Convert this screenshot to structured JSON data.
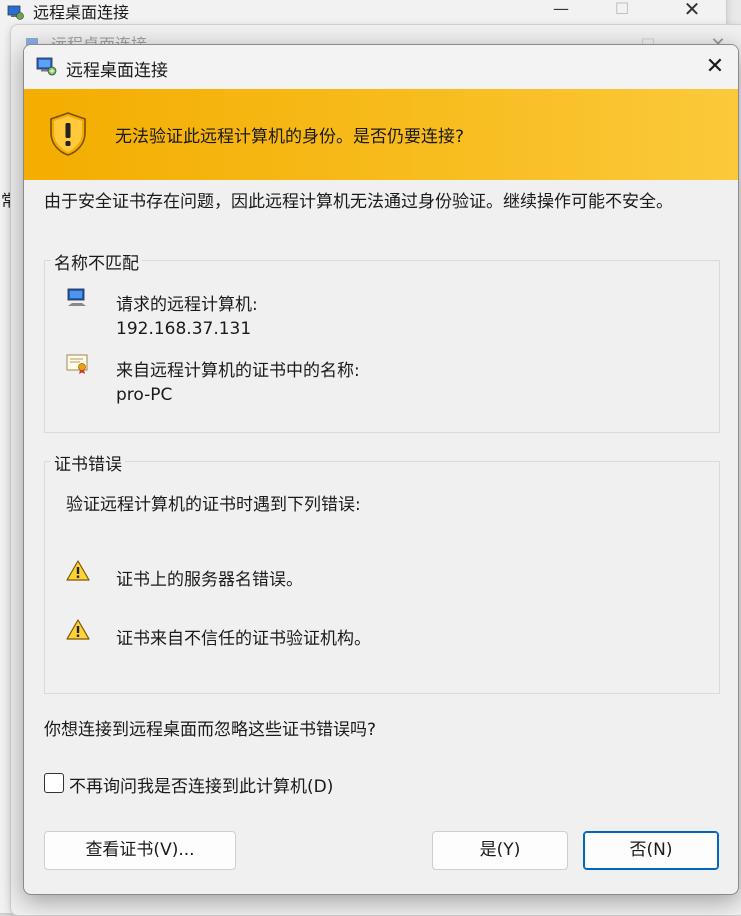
{
  "background_windows": {
    "back_title": "远程桌面连接",
    "middle_title": "远程桌面连接",
    "minimize_glyph": "—",
    "maximize_glyph": "☐",
    "close_glyph": "✕",
    "left_edge_char": "常"
  },
  "dialog": {
    "title": "远程桌面连接",
    "close_glyph": "✕",
    "banner_text": "无法验证此远程计算机的身份。是否仍要连接?",
    "description": "由于安全证书存在问题，因此远程计算机无法通过身份验证。继续操作可能不安全。",
    "name_mismatch": {
      "label": "名称不匹配",
      "requested_label": "请求的远程计算机:",
      "requested_value": "192.168.37.131",
      "cert_name_label": "来自远程计算机的证书中的名称:",
      "cert_name_value": "pro-PC"
    },
    "cert_errors": {
      "label": "证书错误",
      "intro": "验证远程计算机的证书时遇到下列错误:",
      "errors": [
        "证书上的服务器名错误。",
        "证书来自不信任的证书验证机构。"
      ]
    },
    "question": "你想连接到远程桌面而忽略这些证书错误吗?",
    "checkbox_label": "不再询问我是否连接到此计算机(D)",
    "checkbox_checked": false,
    "buttons": {
      "view_cert": "查看证书(V)...",
      "yes": "是(Y)",
      "no": "否(N)"
    },
    "colors": {
      "banner": "#f4ad00",
      "focus_border": "#0067c0"
    }
  }
}
